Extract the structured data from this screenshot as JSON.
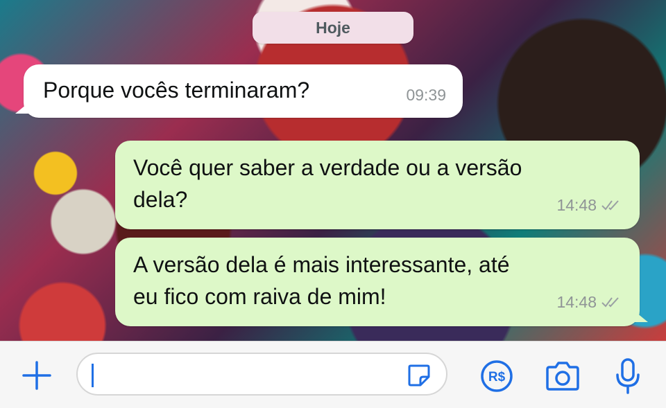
{
  "chat": {
    "date_label": "Hoje",
    "messages": [
      {
        "direction": "incoming",
        "text": "Porque vocês terminaram?",
        "time": "09:39"
      },
      {
        "direction": "outgoing",
        "lines": [
          "Você quer saber a verdade ou a versão",
          "dela?"
        ],
        "time": "14:48",
        "status": "read"
      },
      {
        "direction": "outgoing",
        "lines": [
          "A versão dela é mais interessante, até",
          "eu fico com raiva de mim!"
        ],
        "time": "14:48",
        "status": "read"
      }
    ]
  },
  "input_bar": {
    "message_value": "",
    "icons": [
      "plus-icon",
      "sticker-icon",
      "pix-payment-icon",
      "camera-icon",
      "microphone-icon"
    ],
    "pix_label": "R$"
  },
  "colors": {
    "incoming_bubble": "#ffffff",
    "outgoing_bubble": "#ddf8c8",
    "accent": "#1f6fe5"
  }
}
